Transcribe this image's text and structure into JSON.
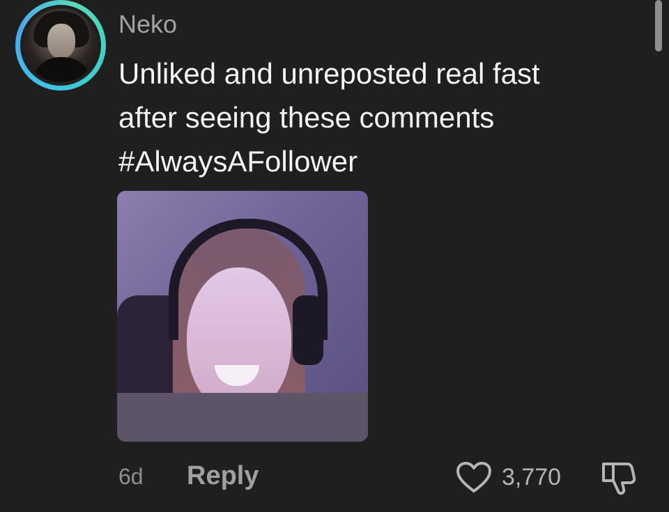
{
  "comment": {
    "username": "Neko",
    "text_lines": [
      "Unliked and unreposted real fast",
      "after seeing these comments",
      "#AlwaysAFollower"
    ],
    "time_ago": "6d",
    "reply_label": "Reply",
    "like_count": "3,770",
    "icons": {
      "like": "heart-icon",
      "dislike": "thumbs-down-icon"
    }
  },
  "colors": {
    "background": "#1f1f1f",
    "avatar_ring": "#3fc3e6",
    "username": "#a3a3a3",
    "text": "#f5f5f5",
    "meta": "#8f8f8f"
  }
}
